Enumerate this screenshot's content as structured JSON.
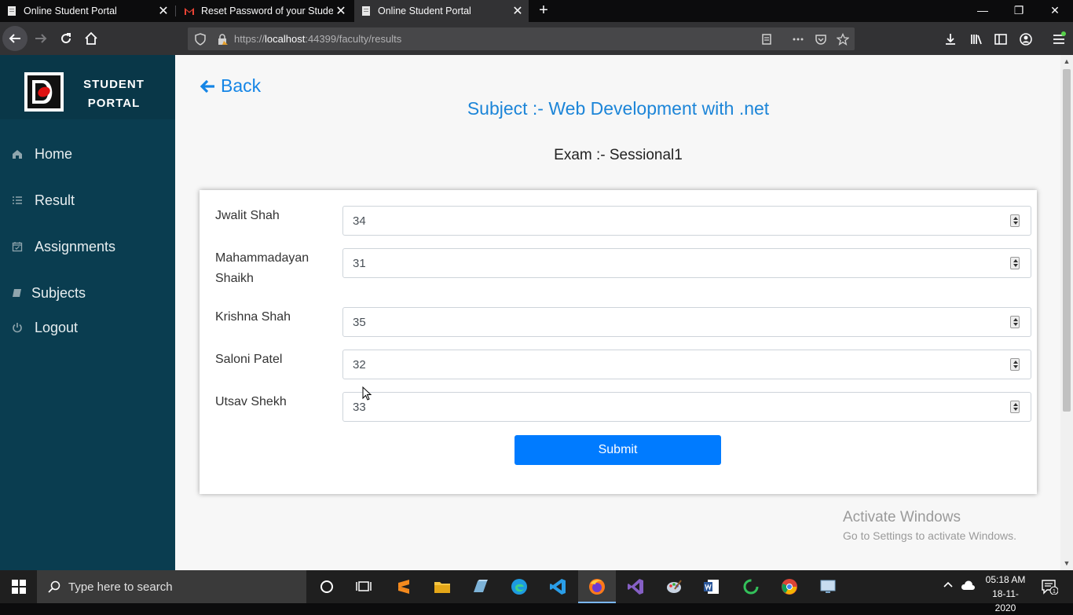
{
  "browser": {
    "tabs": [
      {
        "title": "Online Student Portal",
        "active": false
      },
      {
        "title": "Reset Password of your Student",
        "active": false
      },
      {
        "title": "Online Student Portal",
        "active": true
      }
    ],
    "url_scheme_host_prefix": "https://",
    "url_host": "localhost",
    "url_rest": ":44399/faculty/results"
  },
  "sidebar": {
    "brand_line1": "STUDENT",
    "brand_line2": "PORTAL",
    "items": [
      {
        "label": "Home",
        "icon": "home-icon"
      },
      {
        "label": "Result",
        "icon": "list-icon"
      },
      {
        "label": "Assignments",
        "icon": "calendar-icon"
      },
      {
        "label": "Subjects",
        "icon": "book-icon"
      },
      {
        "label": "Logout",
        "icon": "power-icon"
      }
    ]
  },
  "main": {
    "back_label": "Back",
    "subject_title": "Subject :- Web Development with .net",
    "exam_title": "Exam :- Sessional1",
    "students": [
      {
        "name": "Jwalit Shah",
        "marks": "34"
      },
      {
        "name": "Mahammadayan Shaikh",
        "marks": "31"
      },
      {
        "name": "Krishna Shah",
        "marks": "35"
      },
      {
        "name": "Saloni Patel",
        "marks": "32"
      },
      {
        "name": "Utsav Shekh",
        "marks": "33"
      }
    ],
    "submit_label": "Submit"
  },
  "watermark": {
    "line1": "Activate Windows",
    "line2": "Go to Settings to activate Windows."
  },
  "taskbar": {
    "search_placeholder": "Type here to search",
    "time": "05:18 AM",
    "date": "18-11-2020"
  },
  "colors": {
    "sidebar": "#0a3d50",
    "accent": "#007bff",
    "link": "#1485e6"
  }
}
